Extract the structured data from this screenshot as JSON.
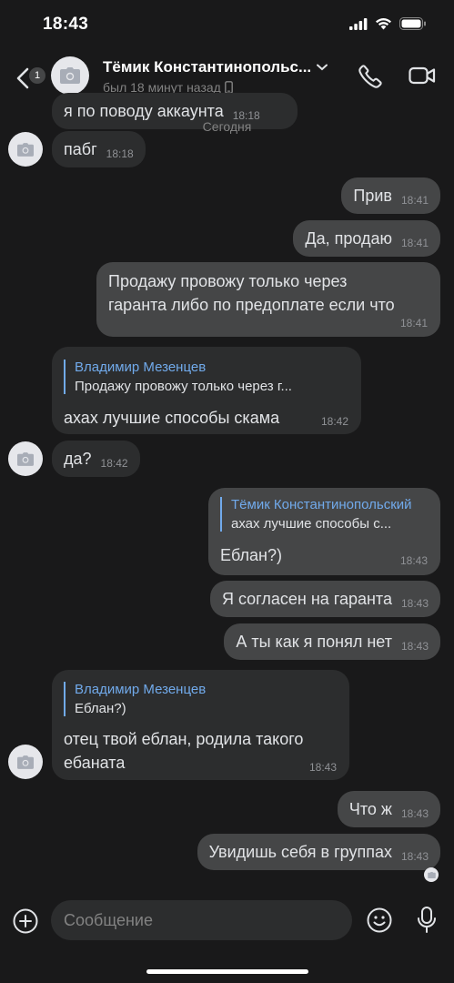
{
  "status": {
    "time": "18:43"
  },
  "header": {
    "back_badge": "1",
    "name": "Тёмик Константинопольс...",
    "last_seen": "был 18 минут назад"
  },
  "date_separator": "Сегодня",
  "messages": [
    {
      "text": "я по поводу аккаунта",
      "time": "18:18"
    },
    {
      "text": "пабг",
      "time": "18:18"
    },
    {
      "text": "Прив",
      "time": "18:41"
    },
    {
      "text": "Да, продаю",
      "time": "18:41"
    },
    {
      "line1": "Продажу провожу только через",
      "line2": "гаранта либо по предоплате если что",
      "time": "18:41"
    },
    {
      "reply_author": "Владимир Мезенцев",
      "reply_text": "Продажу провожу только через г...",
      "text": "ахах лучшие способы скама",
      "time": "18:42"
    },
    {
      "text": "да?",
      "time": "18:42"
    },
    {
      "reply_author": "Тёмик Константинопольский",
      "reply_text": "ахах лучшие способы с...",
      "text": "Еблан?)",
      "time": "18:43"
    },
    {
      "text": "Я согласен на гаранта",
      "time": "18:43"
    },
    {
      "text": "А ты как я понял нет",
      "time": "18:43"
    },
    {
      "reply_author": "Владимир Мезенцев",
      "reply_text": "Еблан?)",
      "line1": "отец твой еблан, родила такого",
      "line2": "ебаната",
      "time": "18:43"
    },
    {
      "text": "Что ж",
      "time": "18:43"
    },
    {
      "text": "Увидишь себя в группах",
      "time": "18:43"
    }
  ],
  "composer": {
    "placeholder": "Сообщение"
  },
  "colors": {
    "background": "#19191a",
    "incoming": "#2c2d2e",
    "outgoing": "#454647",
    "accent": "#71aaeb"
  },
  "icons": [
    "back-chevron-icon",
    "camera-icon",
    "chevron-down-icon",
    "phone-icon",
    "video-camera-icon",
    "mobile-device-icon",
    "plus-circle-icon",
    "emoji-icon",
    "microphone-icon",
    "signal-icon",
    "wifi-icon",
    "battery-icon"
  ]
}
